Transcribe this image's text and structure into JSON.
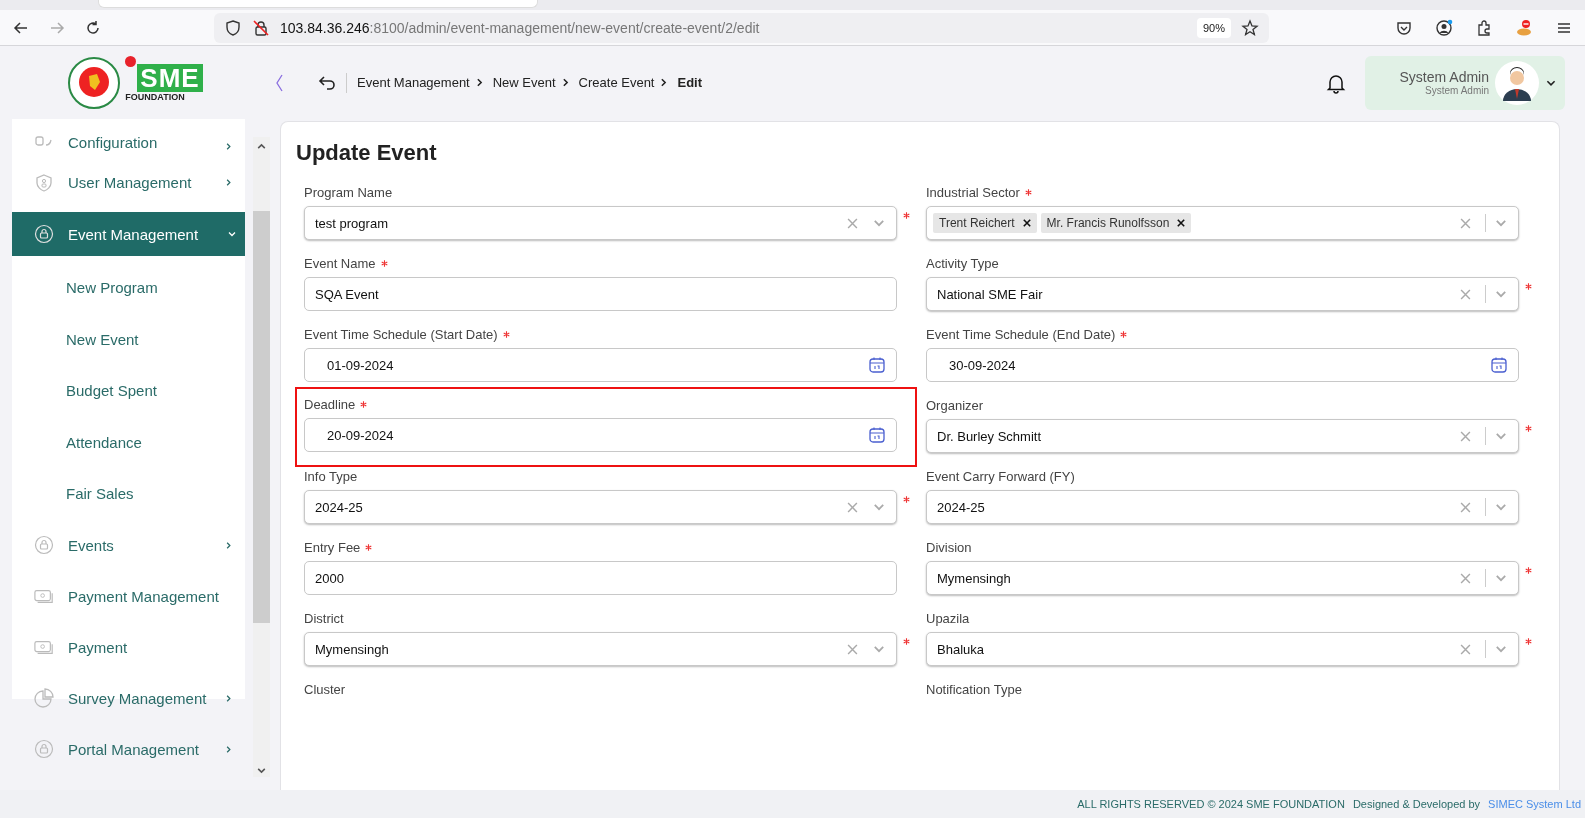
{
  "browser": {
    "url_host": "103.84.36.246",
    "url_path": ":8100/admin/event-management/new-event/create-event/2/edit",
    "zoom": "90%",
    "forward_disabled": true
  },
  "header": {
    "logo": {
      "mark": "SME",
      "tagline": "FOUNDATION"
    },
    "breadcrumb": [
      {
        "label": "Event Management",
        "current": false
      },
      {
        "label": "New Event",
        "current": false
      },
      {
        "label": "Create Event",
        "current": false
      },
      {
        "label": "Edit",
        "current": true
      }
    ],
    "user": {
      "name": "System Admin",
      "role": "System Admin"
    }
  },
  "sidebar": {
    "items": [
      {
        "label": "Configuration",
        "kind": "config",
        "selected": false,
        "expanded": false,
        "expandable": true
      },
      {
        "label": "User Management",
        "kind": "shield",
        "selected": false,
        "expanded": false,
        "expandable": true
      },
      {
        "label": "Event Management",
        "kind": "lock",
        "selected": true,
        "expanded": true,
        "expandable": true,
        "children": [
          {
            "label": "New Program"
          },
          {
            "label": "New Event"
          },
          {
            "label": "Budget Spent"
          },
          {
            "label": "Attendance"
          },
          {
            "label": "Fair Sales"
          }
        ]
      },
      {
        "label": "Events",
        "kind": "lock",
        "selected": false,
        "expanded": false,
        "expandable": true
      },
      {
        "label": "Payment Management",
        "kind": "money",
        "selected": false,
        "expanded": false
      },
      {
        "label": "Payment",
        "kind": "money",
        "selected": false,
        "expanded": false,
        "expandable": false
      },
      {
        "label": "Survey Management",
        "kind": "pie",
        "selected": false,
        "expanded": false,
        "expandable": true
      },
      {
        "label": "Portal Management",
        "kind": "lock",
        "selected": false,
        "expanded": false,
        "expandable": true
      }
    ]
  },
  "form": {
    "title": "Update Event",
    "fields": [
      {
        "label": "Program Name",
        "kind": "select",
        "value": "test program",
        "field_required": true
      },
      {
        "label": "Industrial Sector",
        "kind": "multiselect",
        "tags": [
          "Trent Reichert",
          "Mr. Francis Runolfsson"
        ],
        "label_required": true
      },
      {
        "label": "Event Name",
        "kind": "text",
        "value": "SQA Event",
        "label_required": true
      },
      {
        "label": "Activity Type",
        "kind": "select",
        "value": "National SME Fair",
        "field_required": true
      },
      {
        "label": "Event Time Schedule (Start Date)",
        "kind": "date",
        "value": "01-09-2024",
        "label_required": true
      },
      {
        "label": "Event Time Schedule (End Date)",
        "kind": "date",
        "value": "30-09-2024",
        "label_required": true
      },
      {
        "label": "Deadline",
        "kind": "date",
        "value": "20-09-2024",
        "label_required": true,
        "highlighted": true
      },
      {
        "label": "Organizer",
        "kind": "select",
        "value": "Dr. Burley Schmitt",
        "field_required": true
      },
      {
        "label": "Info Type",
        "kind": "select",
        "value": "2024-25",
        "field_required": true
      },
      {
        "label": "Event Carry Forward (FY)",
        "kind": "select",
        "value": "2024-25"
      },
      {
        "label": "Entry Fee",
        "kind": "text",
        "value": "2000",
        "label_required": true
      },
      {
        "label": "Division",
        "kind": "select",
        "value": "Mymensingh",
        "field_required": true
      },
      {
        "label": "District",
        "kind": "select",
        "value": "Mymensingh",
        "field_required": true
      },
      {
        "label": "Upazila",
        "kind": "select",
        "value": "Bhaluka",
        "field_required": true
      },
      {
        "label": "Cluster",
        "kind": "label_only"
      },
      {
        "label": "Notification Type",
        "kind": "label_only"
      }
    ]
  },
  "footer": {
    "rights": "ALL RIGHTS RESERVED © 2024 SME FOUNDATION",
    "credit": "Designed & Developed by",
    "company": "SIMEC System Ltd"
  }
}
